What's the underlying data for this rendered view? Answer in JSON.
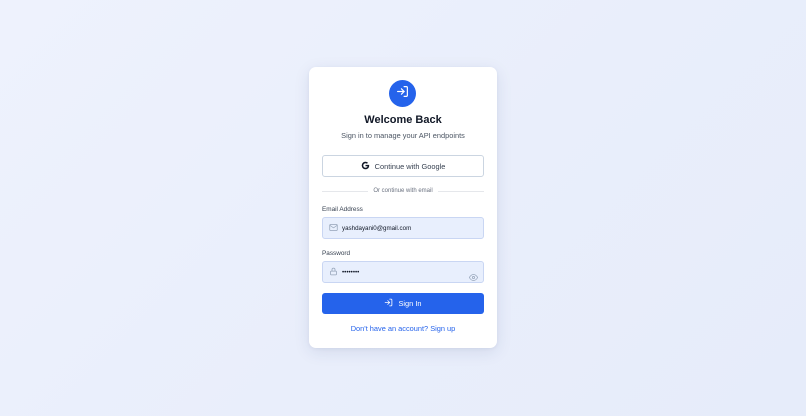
{
  "header": {
    "logo_icon": "sign-in-icon",
    "title": "Welcome Back",
    "subtitle": "Sign in to manage your API endpoints"
  },
  "oauth": {
    "google_label": "Continue with Google",
    "google_icon": "google-g-icon"
  },
  "divider": {
    "text": "Or continue with email"
  },
  "email": {
    "label": "Email Address",
    "value": "yashdayani0@gmail.com",
    "icon": "mail-icon"
  },
  "password": {
    "label": "Password",
    "value": "••••••••",
    "icon": "lock-icon",
    "toggle_icon": "eye-icon"
  },
  "submit": {
    "label": "Sign In",
    "icon": "sign-in-icon"
  },
  "footer": {
    "signup_text": "Don't have an account? Sign up"
  },
  "colors": {
    "accent": "#2563eb",
    "field_bg": "#e8effd",
    "page_bg": "#eef2fd"
  }
}
